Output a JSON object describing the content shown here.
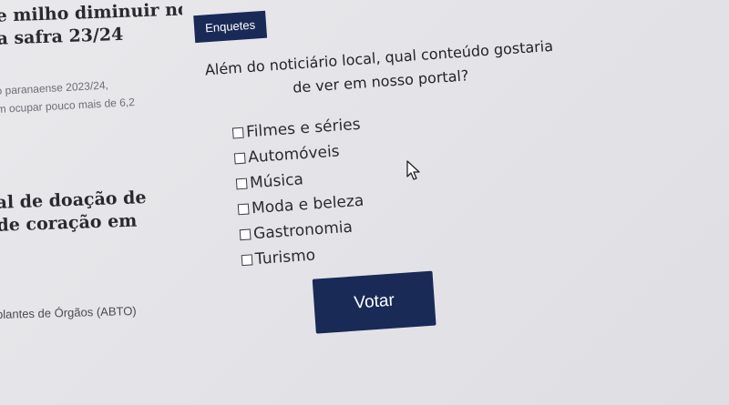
{
  "news": [
    {
      "title_lines": [
        "e milho diminuir no",
        "a safra 23/24"
      ]
    },
    {
      "summary_lines": [
        "o paranaense 2023/24,",
        "m ocupar pouco mais de 6,2"
      ]
    },
    {
      "title_lines": [
        "al de doação de",
        "de coração em"
      ]
    },
    {
      "caption": "plantes de Órgãos (ABTO)"
    }
  ],
  "poll": {
    "tab_label": "Enquetes",
    "question_lines": [
      "Além do noticiário local, qual conteúdo gostaria",
      "de ver em nosso portal?"
    ],
    "options": [
      "Filmes e séries",
      "Automóveis",
      "Música",
      "Moda e beleza",
      "Gastronomia",
      "Turismo"
    ],
    "vote_label": "Votar"
  },
  "colors": {
    "accent": "#1a2a57",
    "page_bg": "#e6e6ea"
  },
  "icons": {
    "cursor": "mouse-pointer-icon",
    "checkbox": "checkbox-icon"
  }
}
